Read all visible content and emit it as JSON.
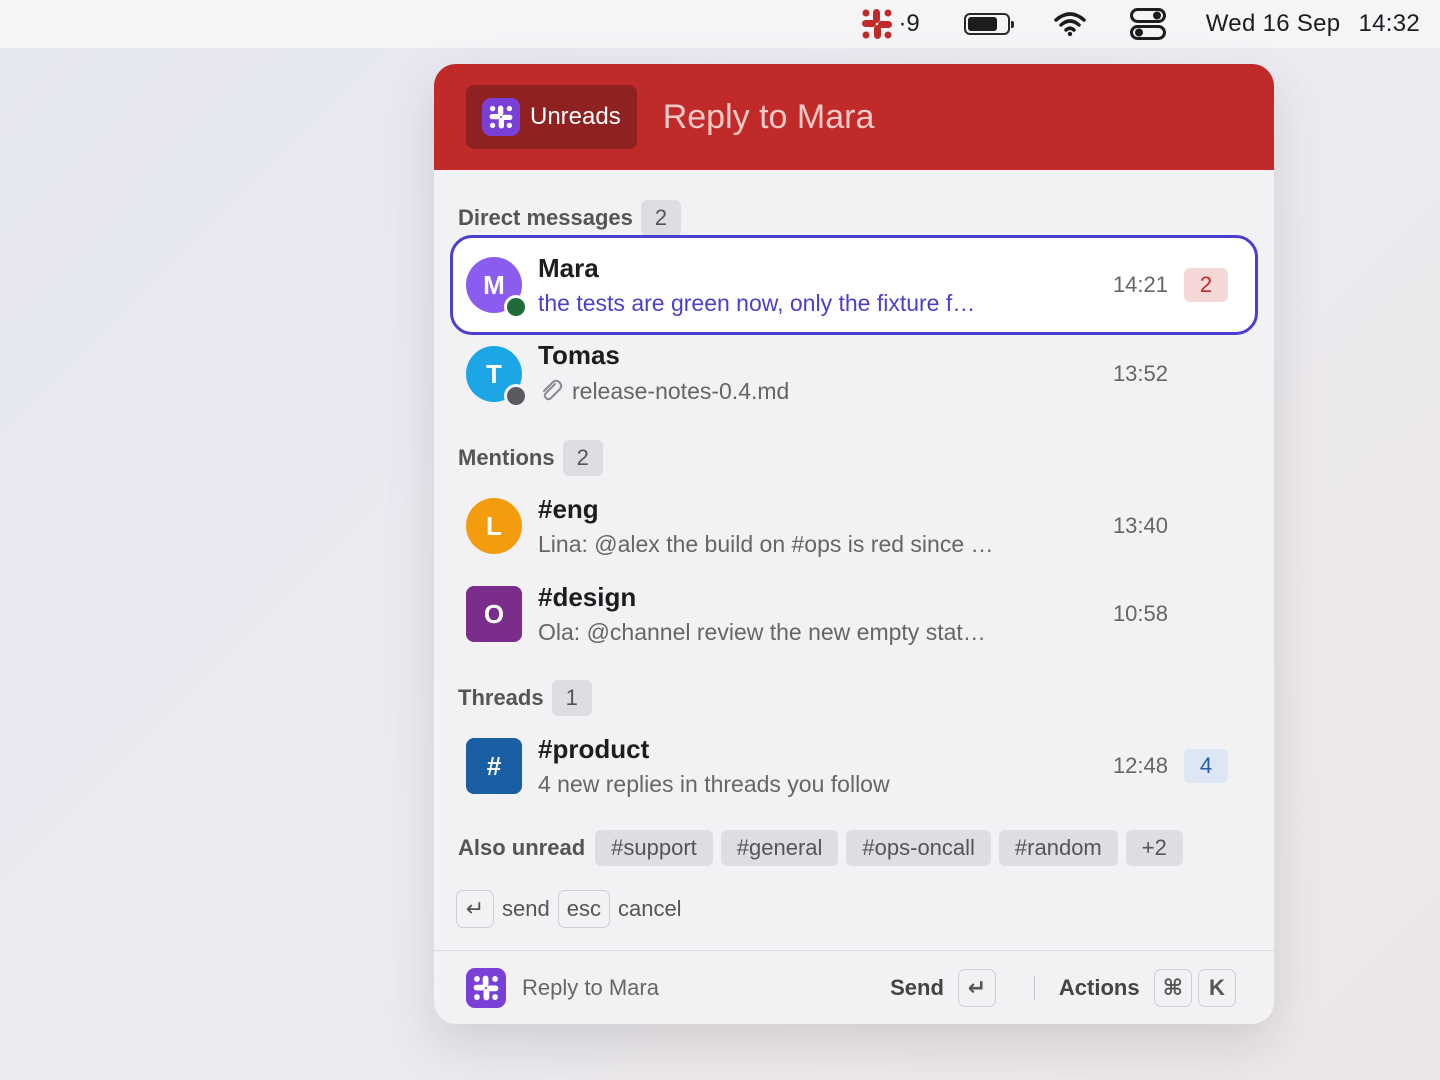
{
  "menubar": {
    "slack_count": "·9",
    "date": "Wed 16 Sep",
    "time": "14:32"
  },
  "header": {
    "chip_label": "Unreads",
    "title": "Reply to Mara"
  },
  "sections": {
    "direct": {
      "label": "Direct messages",
      "count": "2"
    },
    "mentions": {
      "label": "Mentions",
      "count": "2"
    },
    "threads": {
      "label": "Threads",
      "count": "1"
    }
  },
  "rows": [
    {
      "initial": "M",
      "title": "Mara",
      "subtitle": "the tests are green now, only the fixture f…",
      "time": "14:21",
      "badge": "2",
      "avatar_color": "#8b5cf0",
      "presence_color": "#1f6b3a"
    },
    {
      "initial": "T",
      "title": "Tomas",
      "subtitle": "release-notes-0.4.md",
      "time": "13:52",
      "avatar_color": "#1da6e6",
      "presence_color": "#5a5a60"
    },
    {
      "initial": "L",
      "title": "#eng",
      "subtitle": "Lina: @alex the build on #ops is red since …",
      "time": "13:40",
      "avatar_color": "#f39c0e"
    },
    {
      "initial": "O",
      "title": "#design",
      "subtitle": "Ola: @channel review the new empty stat…",
      "time": "10:58",
      "avatar_color": "#7a2d8a"
    },
    {
      "initial": "#",
      "title": "#product",
      "subtitle": "4 new replies in threads you follow",
      "time": "12:48",
      "badge": "4",
      "avatar_color": "#1a5fa3"
    }
  ],
  "also_unread": {
    "label": "Also unread",
    "tags": [
      "#support",
      "#general",
      "#ops-oncall",
      "#random",
      "+2"
    ]
  },
  "hints": {
    "send_key": "↵",
    "send_label": "send",
    "cancel_key": "esc",
    "cancel_label": "cancel"
  },
  "footer": {
    "title": "Reply to Mara",
    "send_label": "Send",
    "send_key": "↵",
    "actions_label": "Actions",
    "cmd_key": "⌘",
    "k_key": "K"
  }
}
